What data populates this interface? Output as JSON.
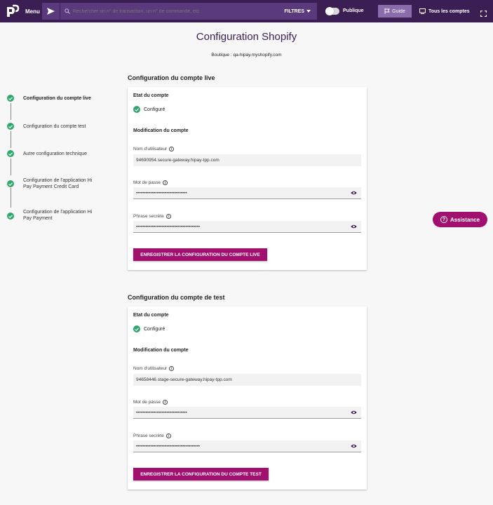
{
  "topbar": {
    "menu_label": "Menu",
    "search_placeholder": "Rechercher un n° de transaction, un n° de commande, etc",
    "filters_label": "FILTRES",
    "public_label": "Publique",
    "guide_label": "Guide",
    "accounts_label": "Tous les comptes"
  },
  "page": {
    "title": "Configuration Shopify",
    "shop": "Boutique : qa-hipay.myshopify.com"
  },
  "steps": [
    {
      "label": "Configuration du compte live"
    },
    {
      "label": "Configuration du compte test"
    },
    {
      "label": "Autre configuration technique"
    },
    {
      "label": "Configuration de l'application Hi Pay Payment Credit Card"
    },
    {
      "label": "Configuration de l'application Hi Pay Payment"
    }
  ],
  "live": {
    "title": "Configuration du compte live",
    "state_label": "Etat du compte",
    "status": "Configuré",
    "mod_label": "Modification du compte",
    "user_label": "Nom d'utilisateur",
    "user_value": "94690954.secure-gateway.hipay-tpp.com",
    "password_label": "Mot de passe",
    "password_value": "••••••••••••••••••••••••••••••••",
    "secret_label": "Phrase secrète",
    "secret_value": "••••••••••••••••••••••••••••••••••••••••",
    "save_label": "ENREGISTRER LA CONFIGURATION DU COMPTE LIVE"
  },
  "test": {
    "title": "Configuration du compte de test",
    "state_label": "Etat du compte",
    "status": "Configuré",
    "mod_label": "Modification du compte",
    "user_label": "Nom d'utilisateur",
    "user_value": "94658446.stage-secure-gateway.hipay-tpp.com",
    "password_label": "Mot de passe",
    "password_value": "••••••••••••••••••••••••••••••••",
    "secret_label": "Phrase secrète",
    "secret_value": "••••••••••••••••••••••••••••••••••••••••",
    "save_label": "ENREGISTRER LA CONFIGURATION DU COMPTE TEST"
  },
  "assistance_label": "Assistance",
  "colors": {
    "topbar": "#3b1e54",
    "accent": "#a1106f",
    "success": "#2ea86b"
  }
}
